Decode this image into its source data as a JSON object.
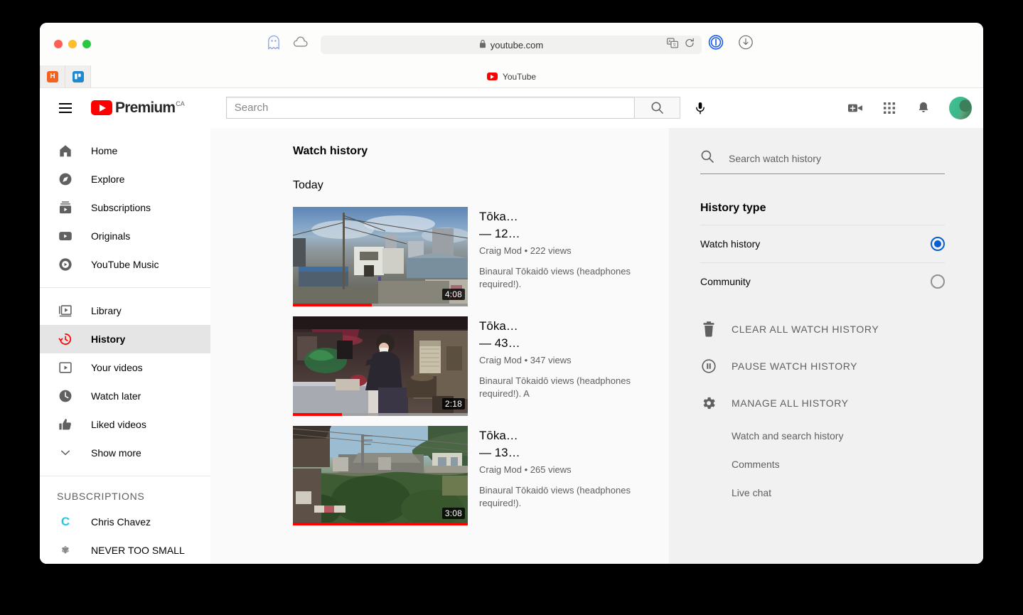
{
  "browser": {
    "url": "youtube.com",
    "lock_icon": "lock-icon",
    "pinned_tabs": [
      {
        "name": "pinned-tab-h",
        "glyph": "H"
      },
      {
        "name": "pinned-tab-trello",
        "glyph": ""
      }
    ],
    "active_tab_title": "YouTube",
    "toolbar_icons_left": [
      "ghostery-icon",
      "cloud-icon"
    ],
    "address_icons": [
      "translate-icon",
      "reload-icon"
    ],
    "toolbar_icons_right": [
      "onepassword-icon",
      "downloads-icon"
    ]
  },
  "masthead": {
    "menu_icon": "hamburger-icon",
    "logo_word": "Premium",
    "logo_superscript": "CA",
    "search_placeholder": "Search",
    "search_value": "",
    "search_icon": "search-icon",
    "mic_icon": "microphone-icon",
    "right_icons": [
      "video-camera-icon",
      "apps-grid-icon",
      "notifications-bell-icon"
    ],
    "avatar": "avatar"
  },
  "sidebar": {
    "primary": [
      {
        "label": "Home",
        "icon": "home-icon",
        "active": false
      },
      {
        "label": "Explore",
        "icon": "compass-icon",
        "active": false
      },
      {
        "label": "Subscriptions",
        "icon": "subscriptions-icon",
        "active": false
      },
      {
        "label": "Originals",
        "icon": "originals-icon",
        "active": false
      },
      {
        "label": "YouTube Music",
        "icon": "music-icon",
        "active": false
      }
    ],
    "secondary": [
      {
        "label": "Library",
        "icon": "library-icon",
        "active": false
      },
      {
        "label": "History",
        "icon": "history-icon",
        "active": true
      },
      {
        "label": "Your videos",
        "icon": "your-videos-icon",
        "active": false
      },
      {
        "label": "Watch later",
        "icon": "clock-icon",
        "active": false
      },
      {
        "label": "Liked videos",
        "icon": "thumbs-up-icon",
        "active": false
      },
      {
        "label": "Show more",
        "icon": "chevron-down-icon",
        "active": false
      }
    ],
    "subscriptions_heading": "SUBSCRIPTIONS",
    "subscriptions": [
      {
        "label": "Chris Chavez",
        "initial": "C",
        "color": "#22c7e8"
      },
      {
        "label": "NEVER TOO SMALL",
        "initial": "*",
        "color": "#888888"
      }
    ]
  },
  "main": {
    "page_title": "Watch history",
    "section_date": "Today",
    "videos": [
      {
        "title_line1": "Tōka…",
        "title_line2": "— 12…",
        "channel": "Craig Mod",
        "views": "222 views",
        "separator": "•",
        "description": "Binaural Tōkaidō views (headphones required!).",
        "duration": "4:08",
        "progress_pct": 45,
        "thumb": "japanese-street-daylight"
      },
      {
        "title_line1": "Tōka…",
        "title_line2": "— 43…",
        "channel": "Craig Mod",
        "views": "347 views",
        "separator": "•",
        "description": "Binaural Tōkaidō views (headphones required!). A",
        "duration": "2:18",
        "progress_pct": 28,
        "thumb": "cafe-interior"
      },
      {
        "title_line1": "Tōka…",
        "title_line2": "— 13…",
        "channel": "Craig Mod",
        "views": "265 views",
        "separator": "•",
        "description": "Binaural Tōkaidō views (headphones required!).",
        "duration": "3:08",
        "progress_pct": 100,
        "thumb": "rural-hillside"
      }
    ]
  },
  "right_panel": {
    "search_placeholder": "Search watch history",
    "search_value": "",
    "search_icon": "search-icon",
    "history_type_title": "History type",
    "options": [
      {
        "label": "Watch history",
        "selected": true
      },
      {
        "label": "Community",
        "selected": false
      }
    ],
    "actions": [
      {
        "label": "CLEAR ALL WATCH HISTORY",
        "icon": "trash-icon"
      },
      {
        "label": "PAUSE WATCH HISTORY",
        "icon": "pause-circle-icon"
      },
      {
        "label": "MANAGE ALL HISTORY",
        "icon": "gear-icon"
      }
    ],
    "sublinks": [
      {
        "label": "Watch and search history"
      },
      {
        "label": "Comments"
      },
      {
        "label": "Live chat"
      }
    ]
  },
  "colors": {
    "brand_red": "#ff0000",
    "accent_blue": "#065fd4",
    "page_bg": "#fafafa",
    "panel_bg": "#f1f1f1",
    "text_primary": "#030303",
    "text_secondary": "#606060"
  }
}
